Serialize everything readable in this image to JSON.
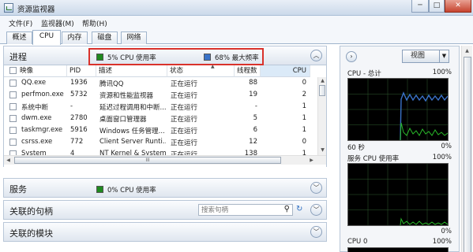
{
  "window": {
    "title": "资源监视器",
    "minimize": "─",
    "maximize": "□",
    "close": "✕"
  },
  "menu": [
    "文件(F)",
    "监视器(M)",
    "帮助(H)"
  ],
  "tabs": [
    "概述",
    "CPU",
    "内存",
    "磁盘",
    "网络"
  ],
  "active_tab": "CPU",
  "processes": {
    "title": "进程",
    "metric_cpu": "5% CPU 使用率",
    "metric_freq": "68% 最大频率",
    "metric_cpu_color": "#1f8a1f",
    "metric_freq_color": "#3a73c9",
    "columns": [
      "映像",
      "PID",
      "描述",
      "状态",
      "线程数",
      "CPU"
    ],
    "rows": [
      {
        "image": "QQ.exe",
        "pid": "1936",
        "desc": "腾讯QQ",
        "status": "正在运行",
        "threads": "88",
        "cpu": "0"
      },
      {
        "image": "perfmon.exe",
        "pid": "5732",
        "desc": "资源和性能监视器",
        "status": "正在运行",
        "threads": "19",
        "cpu": "2"
      },
      {
        "image": "系统中断",
        "pid": "-",
        "desc": "延迟过程调用和中断...",
        "status": "正在运行",
        "threads": "-",
        "cpu": "1"
      },
      {
        "image": "dwm.exe",
        "pid": "2780",
        "desc": "桌面窗口管理器",
        "status": "正在运行",
        "threads": "5",
        "cpu": "1"
      },
      {
        "image": "taskmgr.exe",
        "pid": "5916",
        "desc": "Windows 任务管理...",
        "status": "正在运行",
        "threads": "6",
        "cpu": "1"
      },
      {
        "image": "csrss.exe",
        "pid": "772",
        "desc": "Client Server Runti...",
        "status": "正在运行",
        "threads": "12",
        "cpu": "0"
      },
      {
        "image": "System",
        "pid": "4",
        "desc": "NT Kernel & System",
        "status": "正在运行",
        "threads": "138",
        "cpu": "1"
      }
    ],
    "hscroll_grip": "III"
  },
  "services": {
    "title": "服务",
    "metric": "0% CPU 使用率",
    "metric_color": "#1f8a1f"
  },
  "handles": {
    "title": "关联的句柄",
    "search_placeholder": "搜索句柄"
  },
  "modules": {
    "title": "关联的模块"
  },
  "right_panel": {
    "view_label": "视图",
    "graphs": [
      {
        "title": "CPU - 总计",
        "max": "100%",
        "caption_left": "60 秒",
        "caption_right": "0%"
      },
      {
        "title": "服务 CPU 使用率",
        "max": "100%",
        "caption_left": "",
        "caption_right": "0%"
      },
      {
        "title": "CPU 0",
        "max": "100%",
        "caption_left": "",
        "caption_right": ""
      }
    ]
  }
}
